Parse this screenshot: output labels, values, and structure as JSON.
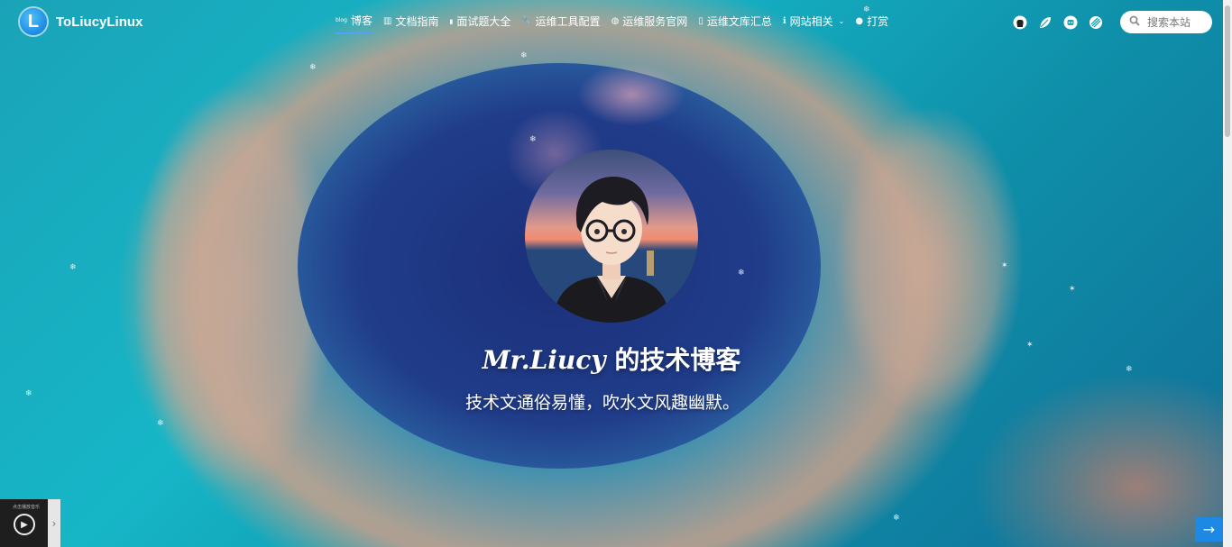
{
  "brand": {
    "logo_letter": "L",
    "title": "ToLiucyLinux"
  },
  "nav": {
    "items": [
      {
        "icon": "blog-icon",
        "icon_text": "blog",
        "label": "博客",
        "active": true
      },
      {
        "icon": "book-icon",
        "icon_text": "▥",
        "label": "文档指南"
      },
      {
        "icon": "note-icon",
        "icon_text": "▮",
        "label": "面试题大全"
      },
      {
        "icon": "wrench-icon",
        "icon_text": "🔧",
        "label": "运维工具配置"
      },
      {
        "icon": "globe-icon",
        "icon_text": "◍",
        "label": "运维服务官网"
      },
      {
        "icon": "file-icon",
        "icon_text": "▯",
        "label": "运维文库汇总"
      },
      {
        "icon": "info-icon",
        "icon_text": "ℹ",
        "label": "网站相关",
        "has_dropdown": true
      },
      {
        "icon": "coin-icon",
        "icon_text": "●",
        "label": "打赏"
      }
    ],
    "right_icons": [
      "github-icon",
      "leaf-icon",
      "robot-icon",
      "theme-icon"
    ],
    "search": {
      "placeholder": "搜索本站"
    }
  },
  "hero": {
    "title_name": "Mr.Liucy",
    "title_rest": " 的技术博客",
    "subtitle": "技术文通俗易懂，吹水文风趣幽默。"
  },
  "player": {
    "label": "点击播放音乐"
  },
  "colors": {
    "accent": "#1e88e5",
    "active_underline": "#4fa3ff"
  }
}
